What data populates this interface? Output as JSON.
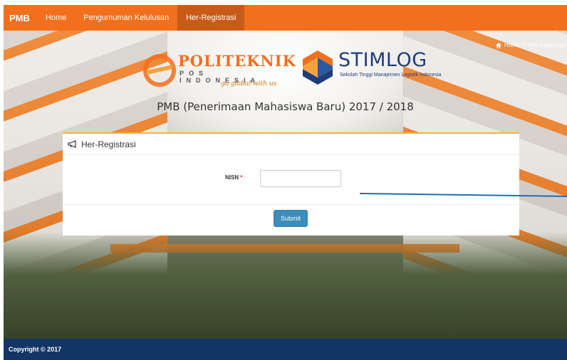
{
  "navbar": {
    "brand": "PMB",
    "items": [
      {
        "label": "Home",
        "active": false
      },
      {
        "label": "Pengumuman Kelulusan",
        "active": false
      },
      {
        "label": "Her-Registrasi",
        "active": true
      }
    ],
    "color": "#f26f1d"
  },
  "breadcrumb": {
    "home": "Home",
    "separator": ">",
    "current": "Her-Registrasi"
  },
  "logos": {
    "politeknik": {
      "name": "POLITEKNIK",
      "sub": "POS INDONESIA",
      "tagline": "go global with us"
    },
    "stimlog": {
      "name": "STIMLOG",
      "sub": "Sekolah Tinggi Manajemen Logistik Indonesia"
    }
  },
  "hero": {
    "title": "PMB (Penerimaan Mahasiswa Baru) 2017 / 2018"
  },
  "panel": {
    "title": "Her-Registrasi",
    "nisn_label": "NISN",
    "required_mark": "*",
    "nisn_value": "",
    "submit_label": "Submit",
    "accent": "#f2b33a",
    "button_color": "#3c8dbc"
  },
  "footer": {
    "text": "Copyright © 2017",
    "color": "#123566"
  }
}
